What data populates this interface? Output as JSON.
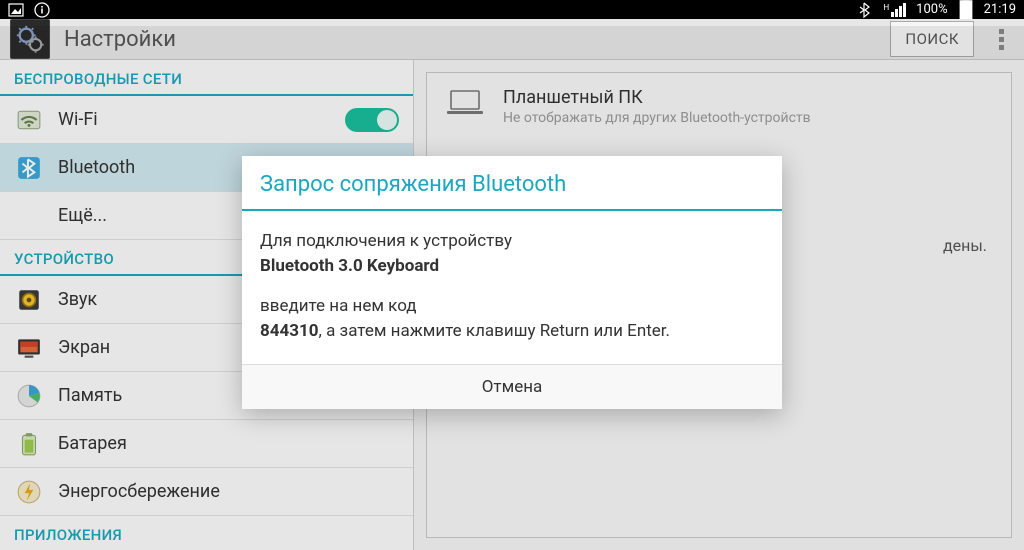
{
  "statusbar": {
    "battery_pct": "100%",
    "clock": "21:19",
    "net_label": "H"
  },
  "actionbar": {
    "title": "Настройки",
    "search": "ПОИСК"
  },
  "sidebar": {
    "cat_wireless": "БЕСПРОВОДНЫЕ СЕТИ",
    "cat_device": "УСТРОЙСТВО",
    "cat_apps": "ПРИЛОЖЕНИЯ",
    "items": {
      "wifi": "Wi-Fi",
      "bluetooth": "Bluetooth",
      "more": "Ещё...",
      "sound": "Звук",
      "display": "Экран",
      "memory": "Память",
      "battery": "Батарея",
      "power": "Энергосбережение"
    },
    "wifi_on": true
  },
  "content": {
    "device_name": "Планшетный ПК",
    "device_sub": "Не отображать для других Bluetooth-устройств",
    "trailing_hint": "дены."
  },
  "dialog": {
    "title": "Запрос сопряжения Bluetooth",
    "line1_prefix": "Для подключения к устройству",
    "device": "Bluetooth 3.0 Keyboard",
    "line2_prefix": "введите на нем код",
    "code": "844310",
    "line2_suffix": ", а затем нажмите клавишу Return или Enter.",
    "cancel": "Отмена"
  }
}
